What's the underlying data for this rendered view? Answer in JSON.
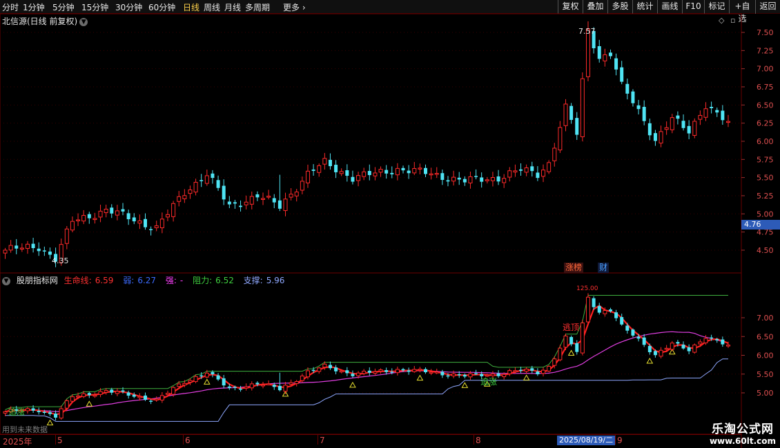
{
  "toolbar": {
    "periods": [
      "分时",
      "1分钟",
      "5分钟",
      "15分钟",
      "30分钟",
      "60分钟",
      "日线",
      "周线",
      "月线",
      "多周期",
      "更多"
    ],
    "active_period": "日线",
    "more_chevron": "›",
    "right_buttons": [
      "复权",
      "叠加",
      "多股",
      "统计",
      "画线",
      "F10",
      "标记",
      "+自选",
      "返回"
    ]
  },
  "main_chart": {
    "title": "北信源(日线 前复权)",
    "y_ticks": [
      "7.50",
      "7.25",
      "7.00",
      "6.75",
      "6.50",
      "6.25",
      "6.00",
      "5.75",
      "5.50",
      "5.25",
      "5.00",
      "4.75",
      "4.50"
    ],
    "high_marker": "7.57",
    "low_marker": "4.35",
    "current_price_tag": "4.76",
    "badges": [
      {
        "text": "涨榜",
        "color": "#ff6a3a",
        "bg": "#3a1010"
      },
      {
        "text": "财",
        "color": "#4aa0ff",
        "bg": "#101a3a"
      }
    ]
  },
  "indicator": {
    "name": "股朋指标网",
    "items": [
      {
        "label": "生命线:",
        "value": "6.59",
        "color": "#ff3030"
      },
      {
        "label": "弱:",
        "value": "6.27",
        "color": "#3c6bff"
      },
      {
        "label": "强:",
        "value": "-",
        "color": "#ff40ff"
      },
      {
        "label": "阻力:",
        "value": "6.52",
        "color": "#3fd03f"
      },
      {
        "label": "支撑:",
        "value": "5.96",
        "color": "#8fa8ff"
      }
    ],
    "y_ticks": [
      "7.00",
      "6.50",
      "6.00",
      "5.50",
      "5.00"
    ],
    "peak_label": "125.00",
    "annotations": [
      {
        "text": "追涨",
        "color": "#3fd03f"
      },
      {
        "text": "追涨",
        "color": "#3fd03f"
      },
      {
        "text": "逃顶",
        "color": "#ff3030"
      }
    ],
    "footer_note": "用到未来数据"
  },
  "date_axis": {
    "labels": [
      "2025年",
      "5",
      "6",
      "7",
      "8",
      "9"
    ],
    "highlight": "2025/08/19/二"
  },
  "watermark": {
    "title": "乐淘公式网",
    "url": "www.60lt.com"
  },
  "colors": {
    "up": "#ff2a2a",
    "down": "#4fe4f4",
    "life_line": "#ff2020",
    "strong_line": "#e03ee0",
    "resist_line": "#3fb03f",
    "support_line": "#8fa8ff",
    "axis": "#6b0000"
  }
}
